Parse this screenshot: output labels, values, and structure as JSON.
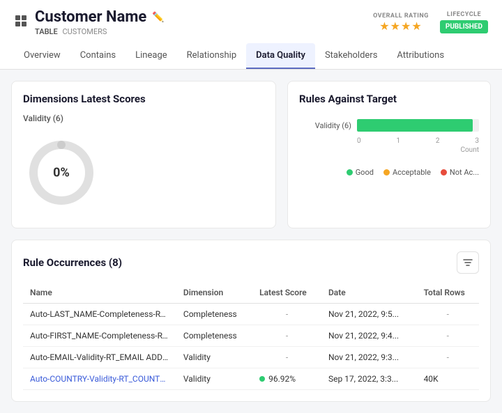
{
  "header": {
    "title": "Customer Name",
    "subtitle_label": "TABLE",
    "subtitle_value": "CUSTOMERS",
    "overall_rating_label": "OVERALL RATING",
    "stars": "★★★★",
    "lifecycle_label": "LIFECYCLE",
    "lifecycle_badge": "PUBLISHED"
  },
  "tabs": [
    {
      "label": "Overview",
      "active": false
    },
    {
      "label": "Contains",
      "active": false
    },
    {
      "label": "Lineage",
      "active": false
    },
    {
      "label": "Relationship",
      "active": false
    },
    {
      "label": "Data Quality",
      "active": true
    },
    {
      "label": "Stakeholders",
      "active": false
    },
    {
      "label": "Attributions",
      "active": false
    }
  ],
  "dimensions_panel": {
    "title": "Dimensions Latest Scores",
    "donut_label": "Validity (6)",
    "donut_value": "0%"
  },
  "rules_panel": {
    "title": "Rules Against Target",
    "bar_label": "Validity (6)",
    "bar_width_pct": 95,
    "axis_values": [
      "0",
      "1",
      "2",
      "3"
    ],
    "axis_unit": "Count",
    "legend": [
      {
        "color": "#2ecc71",
        "label": "Good"
      },
      {
        "color": "#f5a623",
        "label": "Acceptable"
      },
      {
        "color": "#e74c3c",
        "label": "Not Ac..."
      }
    ]
  },
  "rule_occurrences": {
    "title": "Rule Occurrences",
    "count": 8,
    "filter_icon": "▼",
    "columns": [
      "Name",
      "Dimension",
      "Latest Score",
      "Date",
      "Total Rows"
    ],
    "rows": [
      {
        "name": "Auto-LAST_NAME-Completeness-RT_LA...",
        "dimension": "Completeness",
        "latest_score": "-",
        "date": "Nov 21, 2022, 9:5...",
        "total_rows": "-",
        "is_link": false,
        "has_dot": false
      },
      {
        "name": "Auto-FIRST_NAME-Completeness-RT_FI...",
        "dimension": "Completeness",
        "latest_score": "-",
        "date": "Nov 21, 2022, 9:4...",
        "total_rows": "-",
        "is_link": false,
        "has_dot": false
      },
      {
        "name": "Auto-EMAIL-Validity-RT_EMAIL ADDRES...",
        "dimension": "Validity",
        "latest_score": "-",
        "date": "Nov 21, 2022, 9:3...",
        "total_rows": "-",
        "is_link": false,
        "has_dot": false
      },
      {
        "name": "Auto-COUNTRY-Validity-RT_COUNTRY V...",
        "dimension": "Validity",
        "latest_score": "96.92%",
        "date": "Sep 17, 2022, 3:3...",
        "total_rows": "40K",
        "is_link": true,
        "has_dot": true
      }
    ]
  }
}
